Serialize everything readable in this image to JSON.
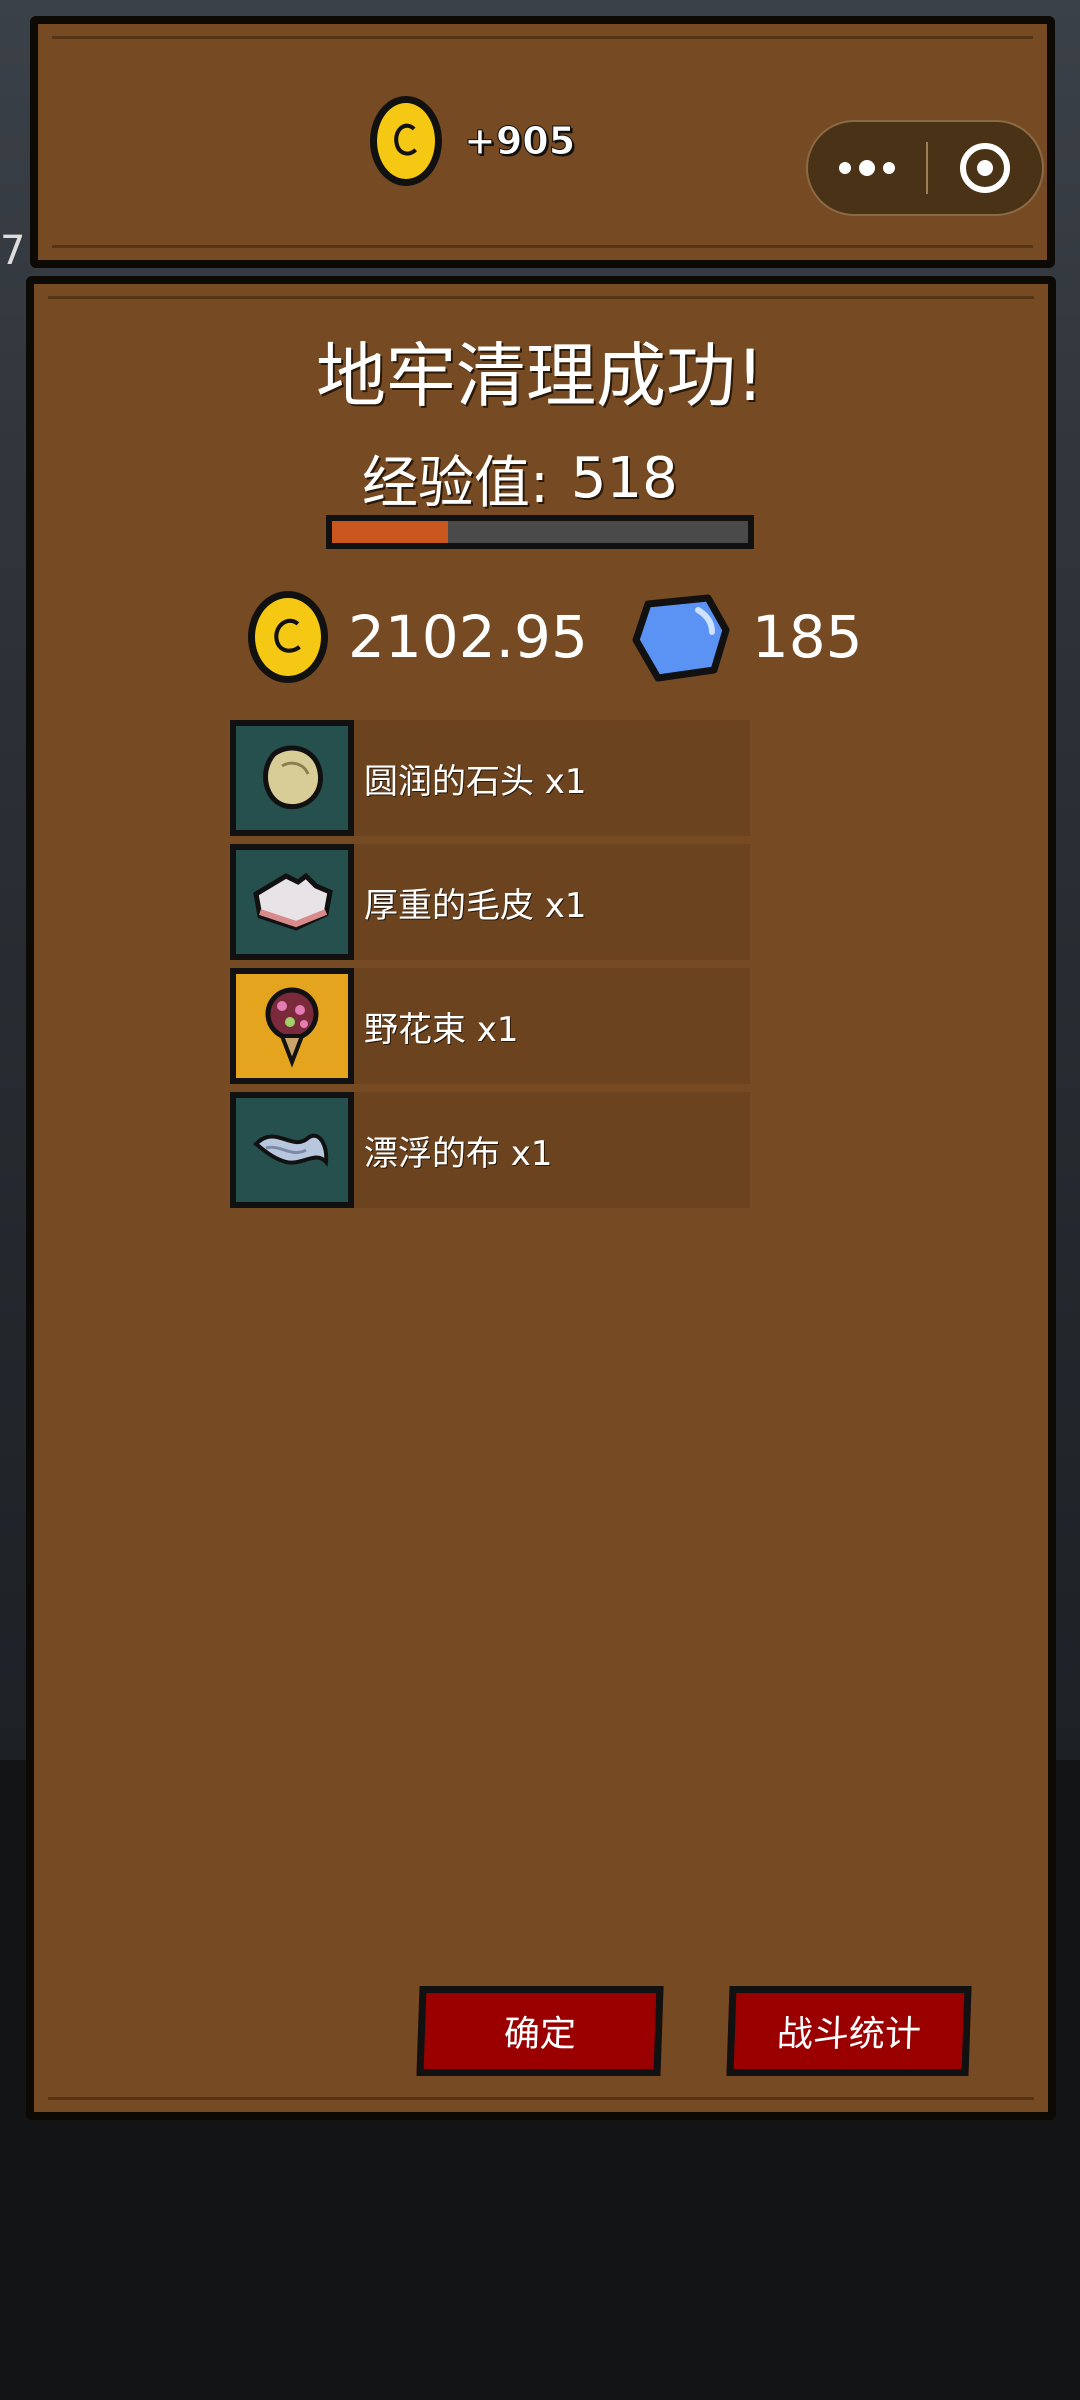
{
  "header": {
    "coin_gain": "+905"
  },
  "background": {
    "edge_text": "7"
  },
  "capsule": {
    "more_icon": "more-dots-icon",
    "close_icon": "target-close-icon"
  },
  "result": {
    "title": "地牢清理成功!",
    "xp_label": "经验值:",
    "xp_value": "518",
    "xp_progress": 0.28
  },
  "rewards": {
    "gold": "2102.95",
    "gems": "185"
  },
  "items": [
    {
      "label": "圆润的石头 x1",
      "icon": "round-stone-icon",
      "bg": "teal"
    },
    {
      "label": "厚重的毛皮 x1",
      "icon": "heavy-fur-icon",
      "bg": "teal"
    },
    {
      "label": "野花束 x1",
      "icon": "flower-bouquet-icon",
      "bg": "gold"
    },
    {
      "label": "漂浮的布 x1",
      "icon": "floating-cloth-icon",
      "bg": "teal"
    }
  ],
  "buttons": {
    "confirm": "确定",
    "stats": "战斗统计"
  },
  "colors": {
    "board": "#764a22",
    "button": "#9b0000",
    "xp_fill": "#c8561d",
    "coin": "#f4c813",
    "gem": "#5b93f5",
    "item_teal": "#25504e",
    "item_gold": "#e5a41d"
  }
}
